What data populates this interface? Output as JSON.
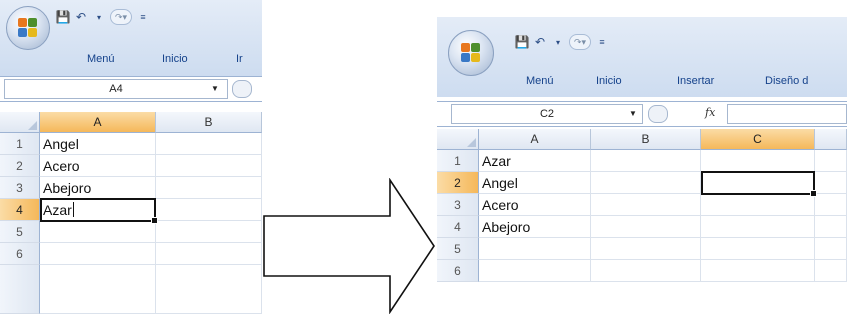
{
  "left_screenshot": {
    "tabs": [
      "Menú",
      "Inicio",
      "Ir"
    ],
    "name_box": "A4",
    "columns": [
      "A",
      "B"
    ],
    "selected_column": "A",
    "rows": [
      "1",
      "2",
      "3",
      "4",
      "5",
      "6"
    ],
    "selected_row": "4",
    "cells_A": [
      "Angel",
      "Acero",
      "Abejoro",
      "Azar",
      "",
      ""
    ],
    "editing_cell": "A4"
  },
  "right_screenshot": {
    "tabs": [
      "Menú",
      "Inicio",
      "Insertar",
      "Diseño d"
    ],
    "name_box": "C2",
    "fx_symbol": "fx",
    "columns": [
      "A",
      "B",
      "C"
    ],
    "selected_column": "C",
    "rows": [
      "1",
      "2",
      "3",
      "4",
      "5",
      "6"
    ],
    "selected_row": "2",
    "cells_A": [
      "Azar",
      "Angel",
      "Acero",
      "Abejoro",
      "",
      ""
    ],
    "active_cell": "C2"
  },
  "icons": {
    "office_button": "office-logo-icon",
    "save": "save-icon",
    "undo": "undo-icon",
    "redo": "redo-icon",
    "customize": "customize-qat-icon",
    "transition": "right-arrow-icon"
  },
  "colors": {
    "ribbon_text": "#15428b",
    "selected_header": "#f5b85a",
    "grid_line": "#dbe2ec"
  }
}
